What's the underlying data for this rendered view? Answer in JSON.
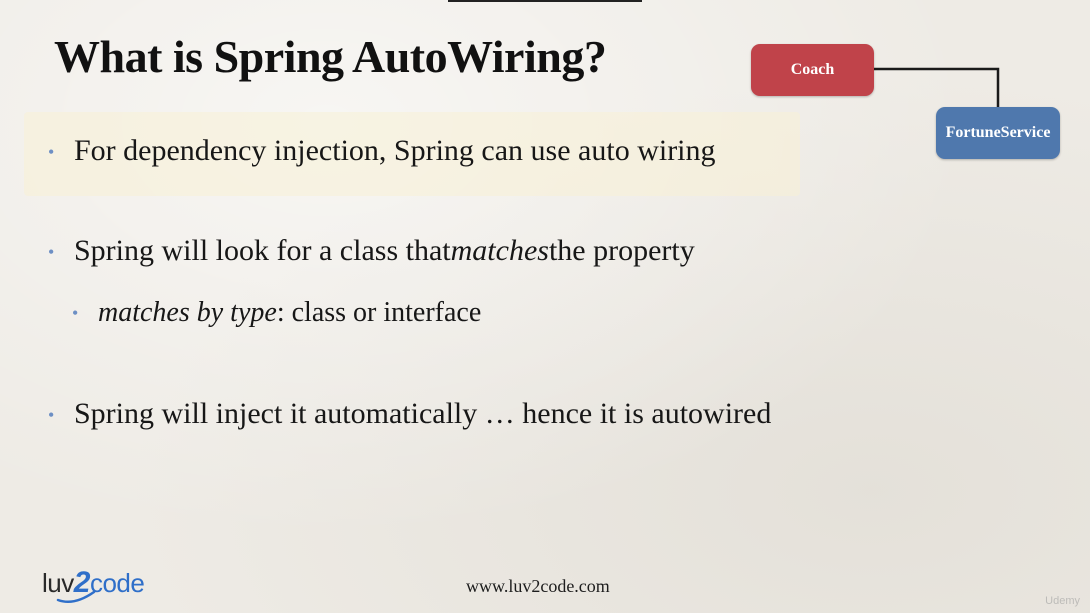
{
  "slide": {
    "title": "What is Spring AutoWiring?",
    "bullets": [
      {
        "parts": [
          {
            "text": "For dependency injection, Spring can use auto wiring",
            "italic": false
          }
        ]
      },
      {
        "parts": [
          {
            "text": "Spring will look for a class that ",
            "italic": false
          },
          {
            "text": "matches",
            "italic": true
          },
          {
            "text": " the property",
            "italic": false
          }
        ]
      },
      {
        "parts": [
          {
            "text": "matches by type",
            "italic": true
          },
          {
            "text": ": class or interface",
            "italic": false
          }
        ]
      },
      {
        "parts": [
          {
            "text": "Spring will inject it automatically … hence it is autowired",
            "italic": false
          }
        ]
      }
    ],
    "bullet_glyph": "•"
  },
  "diagram": {
    "nodes": [
      {
        "label": "Coach",
        "color": "#c0434a"
      },
      {
        "label": "FortuneService",
        "color": "#4f78ad"
      }
    ]
  },
  "footer": {
    "url": "www.luv2code.com",
    "logo": {
      "part1": "luv",
      "part2": "2",
      "part3": "code"
    }
  },
  "colors": {
    "bullet": "#6d8fc4",
    "logo_blue": "#2f6fc9"
  },
  "watermark": "Udemy"
}
